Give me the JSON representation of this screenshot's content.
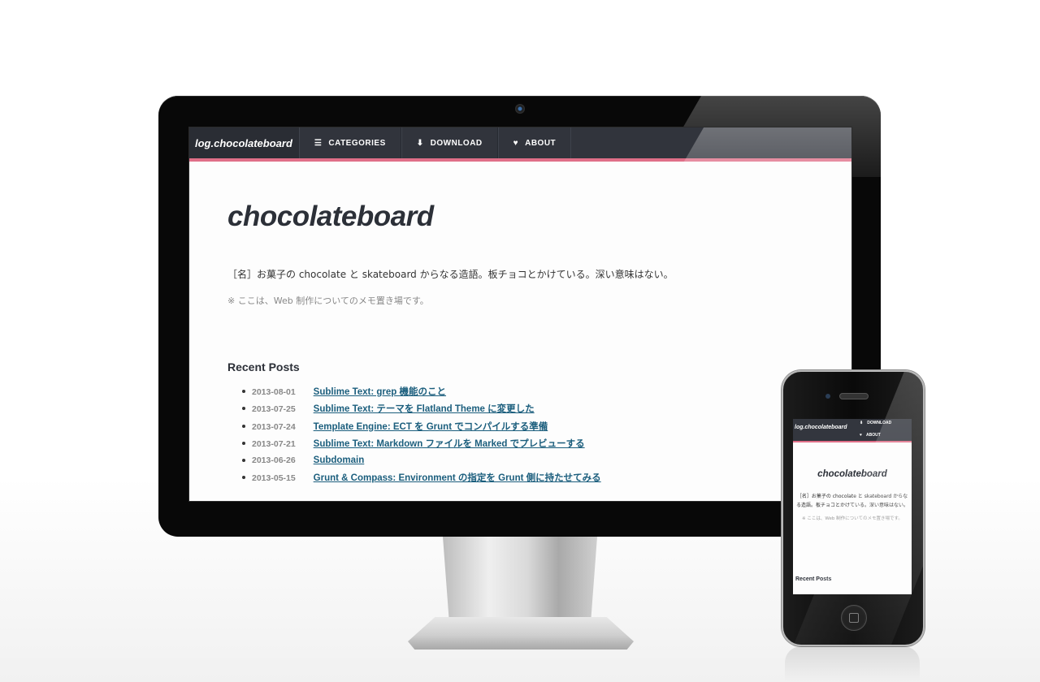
{
  "site": {
    "logo": "log.chocolateboard",
    "nav": [
      {
        "icon": "list-icon",
        "glyph": "☰",
        "label": "CATEGORIES"
      },
      {
        "icon": "download-icon",
        "glyph": "⬇",
        "label": "DOWNLOAD"
      },
      {
        "icon": "heart-icon",
        "glyph": "♥",
        "label": "ABOUT"
      }
    ],
    "title": "chocolateboard",
    "description": "［名］お菓子の chocolate と skateboard からなる造語。板チョコとかけている。深い意味はない。",
    "note": "※ ここは、Web 制作についてのメモ置き場です。",
    "recent_title": "Recent Posts",
    "posts": [
      {
        "date": "2013-08-01",
        "title": "Sublime Text: grep 機能のこと"
      },
      {
        "date": "2013-07-25",
        "title": "Sublime Text: テーマを Flatland Theme に変更した"
      },
      {
        "date": "2013-07-24",
        "title": "Template Engine: ECT を Grunt でコンパイルする準備"
      },
      {
        "date": "2013-07-21",
        "title": "Sublime Text: Markdown ファイルを Marked でプレビューする"
      },
      {
        "date": "2013-06-26",
        "title": "Subdomain"
      },
      {
        "date": "2013-05-15",
        "title": "Grunt & Compass: Environment の指定を Grunt 側に持たせてみる"
      }
    ]
  },
  "phone": {
    "logo": "log.chocolateboard",
    "nav": [
      {
        "icon": "download-icon",
        "glyph": "⬇",
        "label": "DOWNLOAD"
      },
      {
        "icon": "heart-icon",
        "glyph": "♥",
        "label": "ABOUT"
      }
    ],
    "title": "chocolateboard",
    "description": "［名］お菓子の chocolate と skateboard からなる造語。板チョコとかけている。深い意味はない。",
    "note": "※ ここは、Web 制作についてのメモ置き場です。",
    "recent_title": "Recent Posts"
  },
  "colors": {
    "nav_bg": "#31343c",
    "accent": "#e06f88",
    "link": "#1b5e7d"
  }
}
